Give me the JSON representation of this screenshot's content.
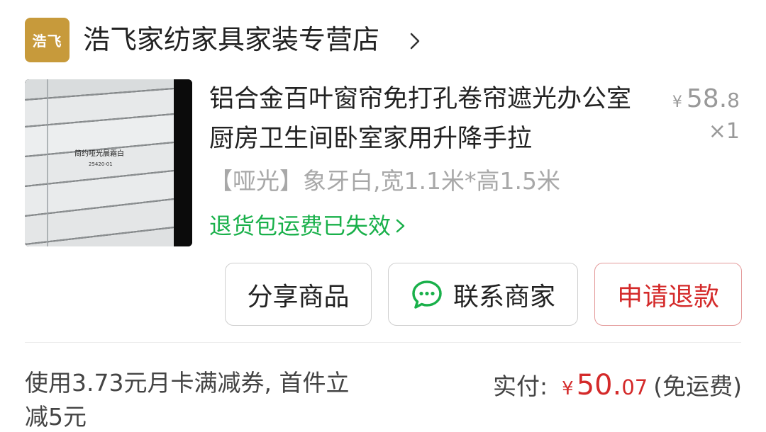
{
  "store": {
    "logo_text": "浩飞",
    "name": "浩飞家纺家具家装专营店",
    "chevron_icon": "chevron-right-icon",
    "logo_color": "#c79a3b"
  },
  "product": {
    "image_label": "简约哑光晨霜白",
    "image_code": "25420-01",
    "title": "铝合金百叶窗帘免打孔卷帘遮光办公室厨房卫生间卧室家用升降手拉",
    "price_symbol": "¥",
    "price_int": "58.",
    "price_dec": "8",
    "quantity": "×1",
    "spec": "【哑光】象牙白,宽1.1米*高1.5米",
    "return_note": "退货包运费已失效",
    "return_note_color": "#19b04a"
  },
  "actions": {
    "share_label": "分享商品",
    "contact_label": "联系商家",
    "contact_icon": "chat-bubble-icon",
    "refund_label": "申请退款",
    "refund_color": "#d42a2a"
  },
  "summary": {
    "coupon_text": "使用3.73元月卡满减券, 首件立减5元",
    "paid_label": "实付:",
    "paid_symbol": "¥",
    "paid_int": "50.",
    "paid_dec": "07",
    "shipping_note": "(免运费)",
    "price_color": "#d42a2a"
  }
}
